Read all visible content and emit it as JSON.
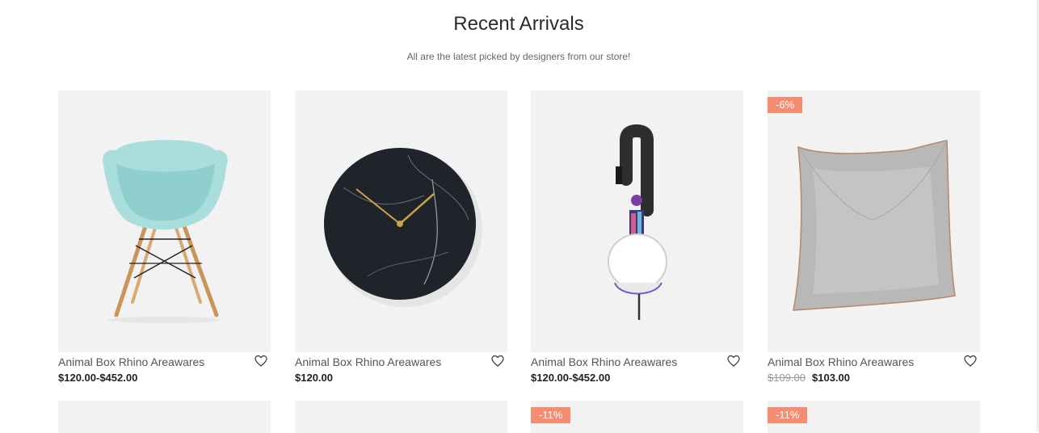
{
  "section": {
    "title": "Recent Arrivals",
    "subtitle": "All are the latest picked by designers from our store!"
  },
  "products": [
    {
      "name": "Animal Box Rhino Areawares",
      "price": "$120.00-$452.00",
      "old_price": "",
      "badge": "",
      "image": "chair"
    },
    {
      "name": "Animal Box Rhino Areawares",
      "price": "$120.00",
      "old_price": "",
      "badge": "",
      "image": "clock"
    },
    {
      "name": "Animal Box Rhino Areawares",
      "price": "$120.00-$452.00",
      "old_price": "",
      "badge": "",
      "image": "headphones"
    },
    {
      "name": "Animal Box Rhino Areawares",
      "price": "$103.00",
      "old_price": "$109.00",
      "badge": "-6%",
      "image": "pillow"
    }
  ],
  "products_row2": [
    {
      "badge": ""
    },
    {
      "badge": ""
    },
    {
      "badge": "-11%"
    },
    {
      "badge": "-11%"
    }
  ],
  "icons": {
    "wishlist": "heart-outline-icon"
  },
  "colors": {
    "badge": "#f58d72",
    "card_bg": "#f2f2f2"
  }
}
